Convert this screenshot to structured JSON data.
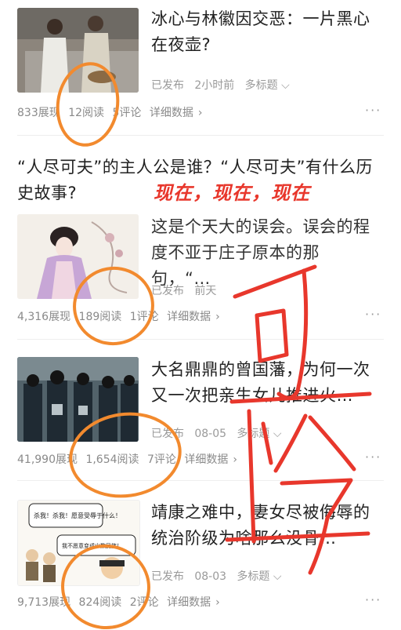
{
  "articles": [
    {
      "title": "冰心与林徽因交恶：一片黑心在夜壶?",
      "status": "已发布",
      "time": "2小时前",
      "extra": "多标题",
      "impressions": "833展现",
      "reads": "12阅读",
      "comments": "5评论",
      "details": "详细数据"
    },
    {
      "title": "“人尽可夫”的主人公是谁？“人尽可夫”有什么历史故事?",
      "summary": "这是个天大的误会。误会的程度不亚于庄子原本的那句，“…",
      "status": "已发布",
      "time": "前天",
      "impressions": "4,316展现",
      "reads": "189阅读",
      "comments": "1评论",
      "details": "详细数据"
    },
    {
      "title": "大名鼎鼎的曾国藩，为何一次又一次把亲生女儿推进火…",
      "status": "已发布",
      "time": "08-05",
      "extra": "多标题",
      "impressions": "41,990展现",
      "reads": "1,654阅读",
      "comments": "7评论",
      "details": "详细数据"
    },
    {
      "title": "靖康之难中，妻女尽被侮辱的统治阶级为啥那么没骨…",
      "status": "已发布",
      "time": "08-03",
      "extra": "多标题",
      "impressions": "9,713展现",
      "reads": "824阅读",
      "comments": "2评论",
      "details": "详细数据"
    }
  ],
  "annotations": {
    "caption": "现在，现在，现在",
    "handwriting": "可怜",
    "color": "#e8372c",
    "circle_color": "#f28a2e"
  },
  "comic_bubbles": {
    "top": "杀我！杀我！愿意受辱于什么！",
    "bottom": "我不愿意变成少数民族！"
  },
  "colors": {
    "title": "#222222",
    "meta": "#9a9a9a",
    "divider": "#eeeeee"
  }
}
